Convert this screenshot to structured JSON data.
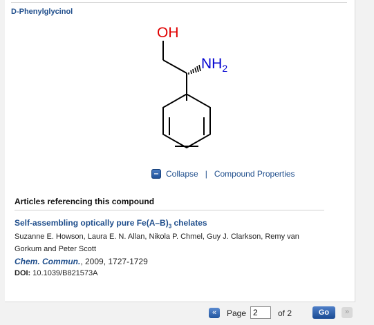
{
  "compound": {
    "name": "D-Phenylglycinol",
    "labels": {
      "oh": "OH",
      "nh": "NH",
      "nh_sub": "2"
    }
  },
  "actions": {
    "collapse_label": "Collapse",
    "separator": "|",
    "properties_label": "Compound Properties"
  },
  "articles": {
    "heading": "Articles referencing this compound",
    "items": [
      {
        "title_pre": "Self-assembling optically pure Fe(A–B)",
        "title_sub": "3",
        "title_post": " chelates",
        "authors": "Suzanne E. Howson, Laura E. N. Allan, Nikola P. Chmel, Guy J. Clarkson, Remy van Gorkum and Peter Scott",
        "journal": "Chem. Commun.",
        "citation": ", 2009, 1727-1729",
        "doi_label": "DOI:",
        "doi": " 10.1039/B821573A"
      }
    ]
  },
  "pager": {
    "page_label": "Page",
    "current_page": "2",
    "of_label": "of 2",
    "go_label": "Go"
  },
  "colors": {
    "link": "#1f4e8c",
    "oxygen": "#e00000",
    "nitrogen": "#0000d0"
  }
}
